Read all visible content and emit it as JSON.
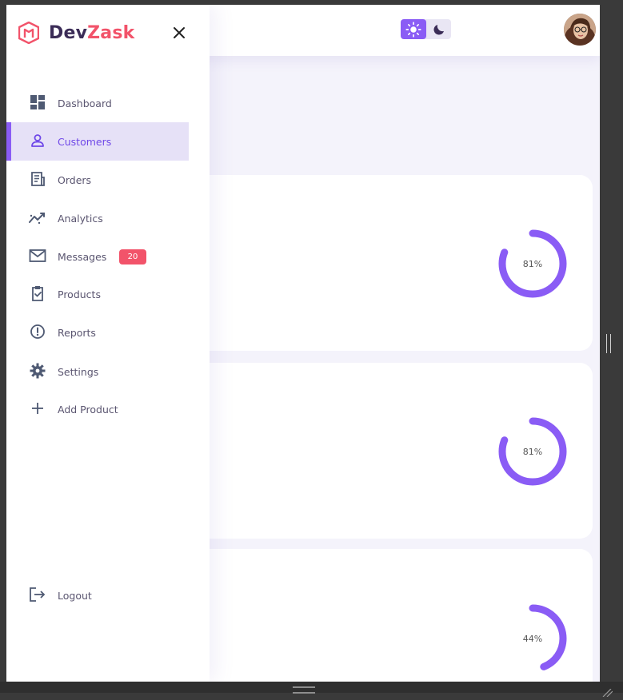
{
  "brand": {
    "prefix": "Dev",
    "suffix": "Zask",
    "logo_color": "#f2536a"
  },
  "colors": {
    "accent": "#8a5cf5",
    "badge": "#f2536a",
    "active_bg": "#e6e1f7"
  },
  "sidebar": {
    "items": [
      {
        "label": "Dashboard",
        "icon": "dashboard-icon"
      },
      {
        "label": "Customers",
        "icon": "person-icon",
        "active": true
      },
      {
        "label": "Orders",
        "icon": "receipt-icon"
      },
      {
        "label": "Analytics",
        "icon": "trending-icon"
      },
      {
        "label": "Messages",
        "icon": "mail-icon",
        "badge": "20"
      },
      {
        "label": "Products",
        "icon": "clipboard-check-icon"
      },
      {
        "label": "Reports",
        "icon": "alert-circle-icon"
      },
      {
        "label": "Settings",
        "icon": "gear-icon"
      },
      {
        "label": "Add Product",
        "icon": "plus-icon"
      }
    ],
    "logout": {
      "label": "Logout",
      "icon": "logout-icon"
    }
  },
  "header": {
    "theme_modes": [
      "light",
      "dark"
    ],
    "active_theme": "light"
  },
  "cards": [
    {
      "percent_label": "81%",
      "percent": 81
    },
    {
      "percent_label": "81%",
      "percent": 81
    },
    {
      "percent_label": "44%",
      "percent": 44
    }
  ]
}
